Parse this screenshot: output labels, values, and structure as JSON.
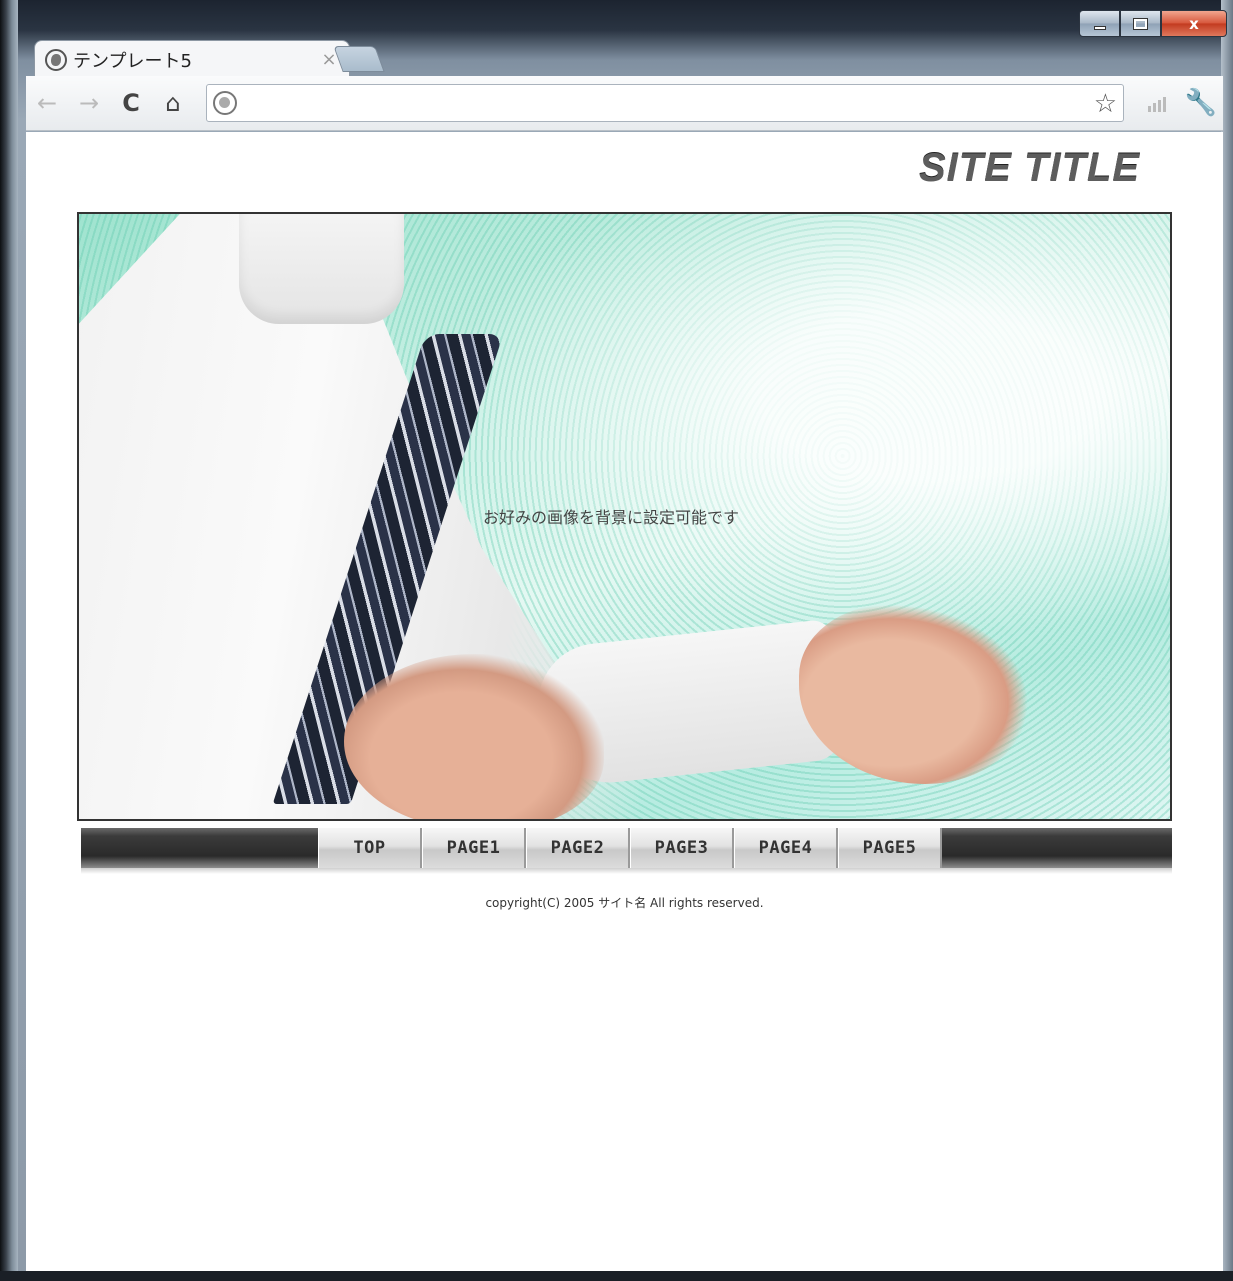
{
  "browser": {
    "tab": {
      "title": "テンプレート5",
      "close_glyph": "×"
    },
    "toolbar": {
      "back_glyph": "←",
      "forward_glyph": "→",
      "reload_glyph": "C",
      "home_glyph": "⌂",
      "address_value": "",
      "star_glyph": "☆",
      "wrench_glyph": "🔧"
    },
    "window_controls": {
      "close_glyph": "x"
    }
  },
  "page": {
    "site_title": "SITE TITLE",
    "hero_text": "お好みの画像を背景に設定可能です",
    "nav": [
      {
        "label": "TOP"
      },
      {
        "label": "PAGE1"
      },
      {
        "label": "PAGE2"
      },
      {
        "label": "PAGE3"
      },
      {
        "label": "PAGE4"
      },
      {
        "label": "PAGE5"
      }
    ],
    "copyright": "copyright(C) 2005 サイト名 All rights reserved."
  },
  "colors": {
    "hero_accent": "#9fe3cf",
    "nav_dark": "#2a2a2a",
    "close_button": "#c23a1f"
  }
}
